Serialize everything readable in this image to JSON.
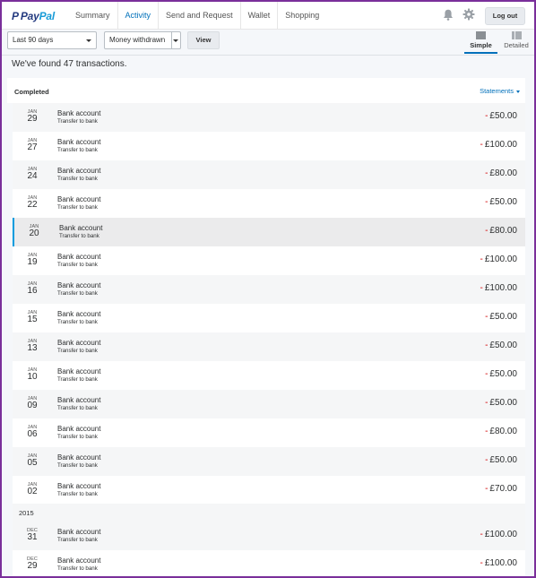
{
  "header": {
    "logo_pay": "Pay",
    "logo_pal": "Pal",
    "nav": [
      "Summary",
      "Activity",
      "Send and Request",
      "Wallet",
      "Shopping"
    ],
    "active_nav": "Activity",
    "logout_label": "Log out",
    "icons": [
      "bell-icon",
      "gear-icon"
    ]
  },
  "filters": {
    "date_range": "Last 90 days",
    "type": "Money withdrawn",
    "view_label": "View",
    "simple_label": "Simple",
    "detailed_label": "Detailed"
  },
  "summary_text": "We've found 47 transactions.",
  "completed": {
    "label": "Completed",
    "statements_label": "Statements"
  },
  "transactions": [
    {
      "month": "JAN",
      "day": "29",
      "title": "Bank account",
      "subtitle": "Transfer to bank",
      "sign": "-",
      "amount": "£50.00"
    },
    {
      "month": "JAN",
      "day": "27",
      "title": "Bank account",
      "subtitle": "Transfer to bank",
      "sign": "-",
      "amount": "£100.00"
    },
    {
      "month": "JAN",
      "day": "24",
      "title": "Bank account",
      "subtitle": "Transfer to bank",
      "sign": "-",
      "amount": "£80.00"
    },
    {
      "month": "JAN",
      "day": "22",
      "title": "Bank account",
      "subtitle": "Transfer to bank",
      "sign": "-",
      "amount": "£50.00"
    },
    {
      "month": "JAN",
      "day": "20",
      "title": "Bank account",
      "subtitle": "Transfer to bank",
      "sign": "-",
      "amount": "£80.00"
    },
    {
      "month": "JAN",
      "day": "19",
      "title": "Bank account",
      "subtitle": "Transfer to bank",
      "sign": "-",
      "amount": "£100.00"
    },
    {
      "month": "JAN",
      "day": "16",
      "title": "Bank account",
      "subtitle": "Transfer to bank",
      "sign": "-",
      "amount": "£100.00"
    },
    {
      "month": "JAN",
      "day": "15",
      "title": "Bank account",
      "subtitle": "Transfer to bank",
      "sign": "-",
      "amount": "£50.00"
    },
    {
      "month": "JAN",
      "day": "13",
      "title": "Bank account",
      "subtitle": "Transfer to bank",
      "sign": "-",
      "amount": "£50.00"
    },
    {
      "month": "JAN",
      "day": "10",
      "title": "Bank account",
      "subtitle": "Transfer to bank",
      "sign": "-",
      "amount": "£50.00"
    },
    {
      "month": "JAN",
      "day": "09",
      "title": "Bank account",
      "subtitle": "Transfer to bank",
      "sign": "-",
      "amount": "£50.00"
    },
    {
      "month": "JAN",
      "day": "06",
      "title": "Bank account",
      "subtitle": "Transfer to bank",
      "sign": "-",
      "amount": "£80.00"
    },
    {
      "month": "JAN",
      "day": "05",
      "title": "Bank account",
      "subtitle": "Transfer to bank",
      "sign": "-",
      "amount": "£50.00"
    },
    {
      "month": "JAN",
      "day": "02",
      "title": "Bank account",
      "subtitle": "Transfer to bank",
      "sign": "-",
      "amount": "£70.00"
    }
  ],
  "year_divider": "2015",
  "transactions_2015": [
    {
      "month": "DEC",
      "day": "31",
      "title": "Bank account",
      "subtitle": "Transfer to bank",
      "sign": "-",
      "amount": "£100.00"
    },
    {
      "month": "DEC",
      "day": "29",
      "title": "Bank account",
      "subtitle": "Transfer to bank",
      "sign": "-",
      "amount": "£100.00"
    }
  ],
  "colors": {
    "accent": "#0070ba",
    "negative": "#d20000",
    "selected_bar": "#009cde",
    "frame": "#7a2f9a"
  }
}
